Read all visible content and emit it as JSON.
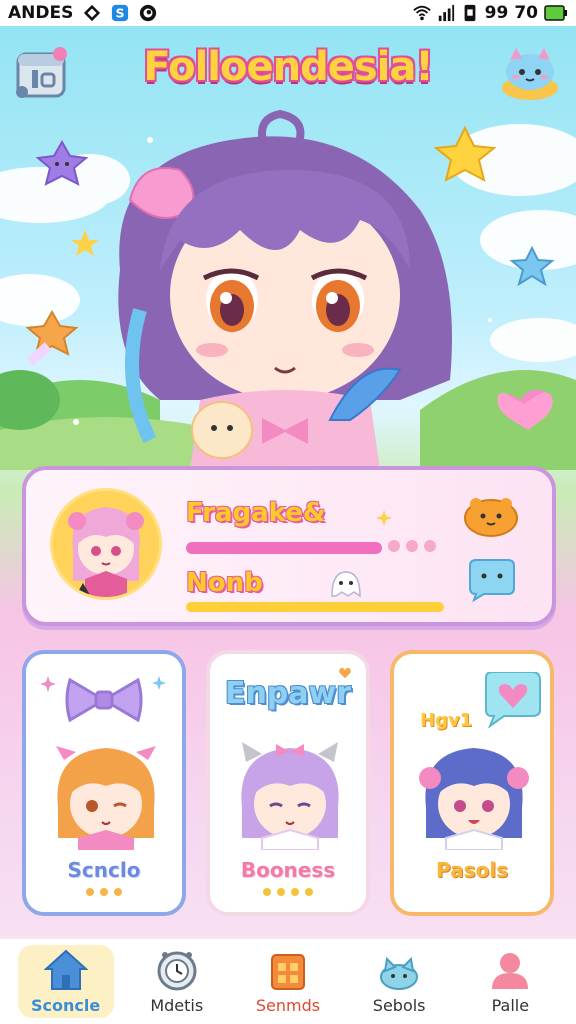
{
  "status_bar": {
    "carrier": "ANDES",
    "time": "99",
    "battery": "70"
  },
  "header": {
    "title": "Folloendesia!",
    "left_icon": "calendar-icon",
    "right_icon": "cat-cup-icon"
  },
  "profile": {
    "name": "Fragake&",
    "status": "Nonb",
    "icons": [
      "bread-icon",
      "chat-bubble-icon"
    ]
  },
  "cards": [
    {
      "title": "",
      "name": "Scnclo",
      "accent": "#8ea7e9",
      "decoration": "bow-icon"
    },
    {
      "title": "Enpawr",
      "name": "Booness",
      "accent": "#f4d8e6"
    },
    {
      "title": "Hgv1",
      "name": "Pasols",
      "accent": "#f7b86c",
      "decoration": "heart-bubble-icon"
    }
  ],
  "nav": {
    "items": [
      {
        "label": "Sconcle",
        "icon": "home-icon",
        "active": true
      },
      {
        "label": "Mdetis",
        "icon": "clock-icon",
        "active": false
      },
      {
        "label": "Senmds",
        "icon": "shop-icon",
        "active": false
      },
      {
        "label": "Sebols",
        "icon": "cat-icon",
        "active": false
      },
      {
        "label": "Palle",
        "icon": "person-icon",
        "active": false
      }
    ]
  },
  "colors": {
    "accent_pink": "#e04f9a",
    "accent_yellow": "#ffd23f",
    "nav_active_bg": "#fdf0c4",
    "nav_active_text": "#3a8ed8"
  }
}
